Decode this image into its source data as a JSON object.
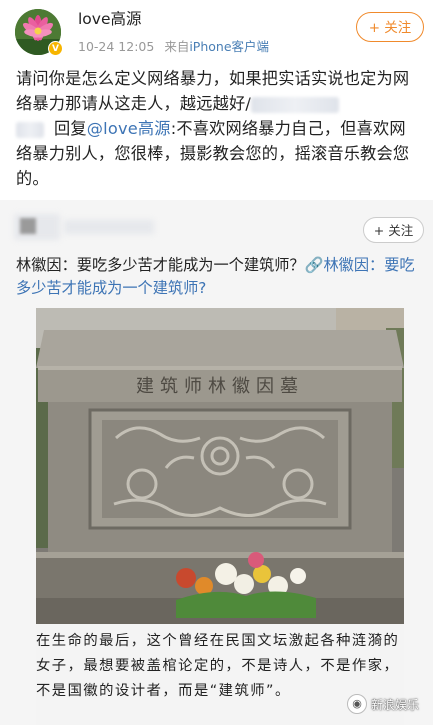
{
  "post": {
    "username": "love高源",
    "date": "10-24 12:05",
    "source_prefix": "来自",
    "source_device": "iPhone客户端",
    "follow_label": "+ 关注",
    "text_part1": "请问你是怎么定义网络暴力，如果把实话实说也定为网络暴力那请从这走人，越远越好/",
    "reply_prefix": "回复",
    "reply_mention": "@love高源",
    "reply_text": ":不喜欢网络暴力自己，但喜欢网络暴力别人，您很棒，摄影教会您的，摇滚音乐教会您的。"
  },
  "quote": {
    "follow_label": "+ 关注",
    "text_plain": "林徽因：要吃多少苦才能成为一个建筑师？",
    "link_text": "🔗林徽因：要吃多少苦才能成为一个建筑师?",
    "photo": {
      "inscription": "建筑师林徽因墓"
    },
    "caption": "在生命的最后，这个曾经在民国文坛激起各种涟漪的女子，最想要被盖棺论定的，不是诗人，不是作家，不是国徽的设计者，而是“建筑师”。"
  },
  "watermark": {
    "text": "新浪娱乐",
    "icon": "sina-eye-icon"
  },
  "colors": {
    "follow_orange": "#f08a2c",
    "link_blue": "#3d74b5",
    "meta_gray": "#999999",
    "quote_bg": "#f5f5f5"
  }
}
